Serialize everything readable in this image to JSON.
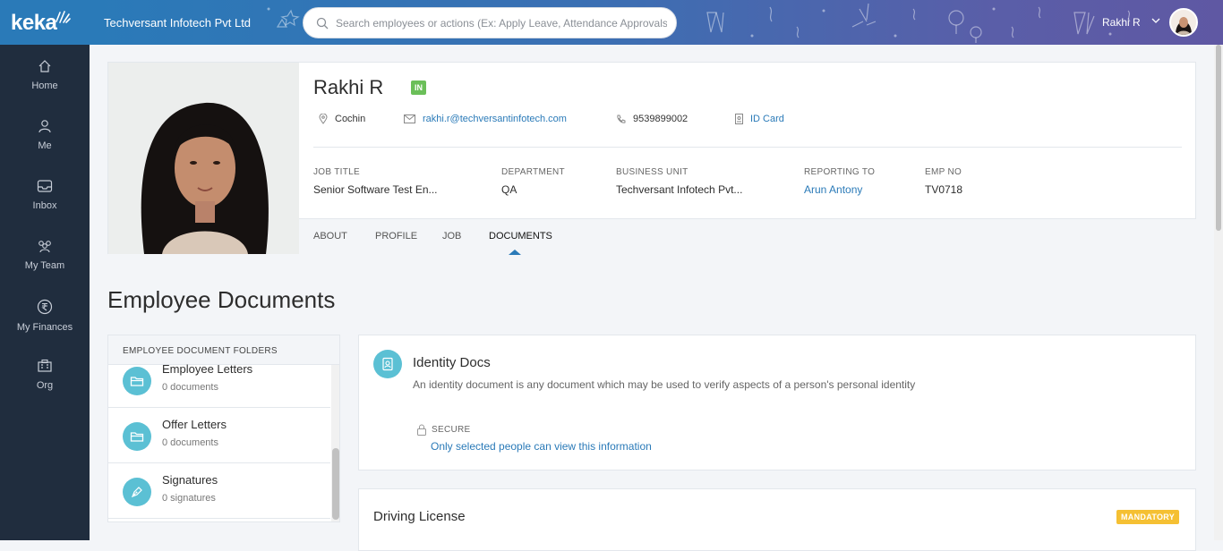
{
  "brand": {
    "logo_text": "keka",
    "primary_color": "#2a7ab8",
    "sidebar_color": "#202d3e"
  },
  "sidebar": {
    "items": [
      {
        "label": "Home",
        "icon": "home-icon"
      },
      {
        "label": "Me",
        "icon": "user-icon"
      },
      {
        "label": "Inbox",
        "icon": "inbox-icon"
      },
      {
        "label": "My Team",
        "icon": "team-icon"
      },
      {
        "label": "My Finances",
        "icon": "rupee-icon"
      },
      {
        "label": "Org",
        "icon": "org-icon"
      }
    ]
  },
  "header": {
    "company": "Techversant Infotech Pvt Ltd",
    "search_placeholder": "Search employees or actions (Ex: Apply Leave, Attendance Approvals)",
    "user_name": "Rakhi R"
  },
  "profile": {
    "name": "Rakhi R",
    "status_badge": "IN",
    "location": "Cochin",
    "email": "rakhi.r@techversantinfotech.com",
    "phone": "9539899002",
    "id_card": "ID Card",
    "fields": [
      {
        "label": "JOB TITLE",
        "value": "Senior Software Test En..."
      },
      {
        "label": "DEPARTMENT",
        "value": "QA"
      },
      {
        "label": "BUSINESS UNIT",
        "value": "Techversant Infotech Pvt..."
      },
      {
        "label": "REPORTING TO",
        "value": "Arun Antony"
      },
      {
        "label": "EMP NO",
        "value": "TV0718"
      }
    ],
    "tabs": [
      "ABOUT",
      "PROFILE",
      "JOB",
      "DOCUMENTS"
    ],
    "active_tab": "DOCUMENTS"
  },
  "documents": {
    "title": "Employee Documents",
    "folders_header": "EMPLOYEE DOCUMENT FOLDERS",
    "folders": [
      {
        "name": "Employee Letters",
        "count": "0 documents",
        "icon": "folder-icon"
      },
      {
        "name": "Offer Letters",
        "count": "0 documents",
        "icon": "folder-icon"
      },
      {
        "name": "Signatures",
        "count": "0 signatures",
        "icon": "pen-icon"
      }
    ],
    "identity": {
      "title": "Identity Docs",
      "description": "An identity document is any document which may be used to verify aspects of a person's personal identity",
      "secure_label": "SECURE",
      "secure_desc": "Only selected people can view this information"
    },
    "driving_license": {
      "title": "Driving License",
      "badge": "MANDATORY"
    }
  }
}
